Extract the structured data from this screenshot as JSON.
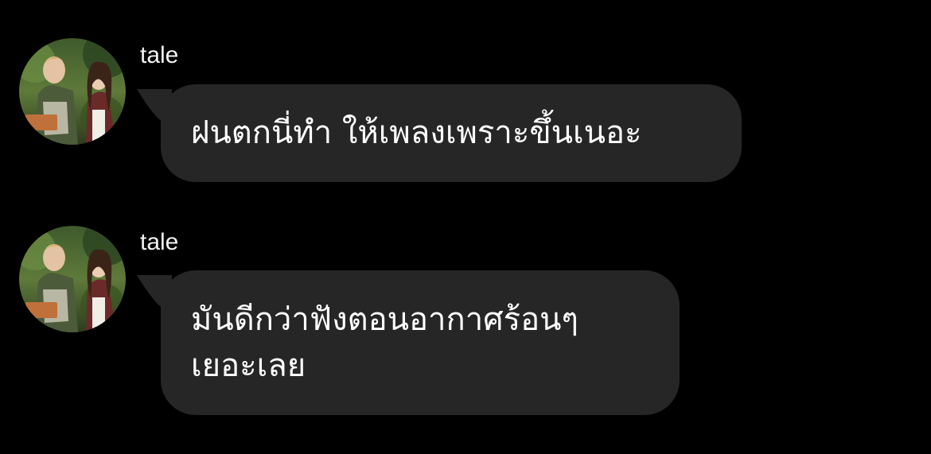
{
  "messages": [
    {
      "sender": "tale",
      "text": "ฝนตกนี่ทำ ให้เพลงเพราะขึ้นเนอะ",
      "avatar": "couple-photo-avatar"
    },
    {
      "sender": "tale",
      "text": "มันดีกว่าฟังตอนอากาศร้อนๆ\nเยอะเลย",
      "avatar": "couple-photo-avatar"
    }
  ],
  "colors": {
    "background": "#000000",
    "bubble": "#262626",
    "text": "#ffffff",
    "sender": "#f2f2f2"
  }
}
